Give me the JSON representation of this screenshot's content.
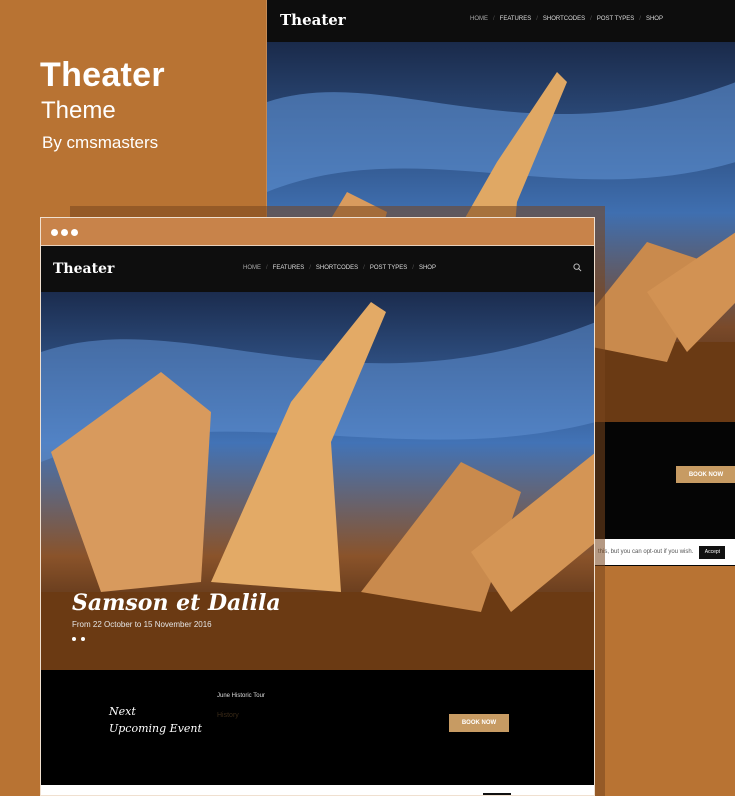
{
  "promo": {
    "title": "Theater",
    "subtitle": "Theme",
    "author": "By cmsmasters"
  },
  "site": {
    "logo": "Theater",
    "menu": [
      "HOME",
      "FEATURES",
      "SHORTCODES",
      "POST TYPES",
      "SHOP"
    ],
    "search_icon": "search-icon"
  },
  "hero": {
    "title": "Samson et Dalila",
    "date": "From 22 October to 15 November 2016"
  },
  "event": {
    "heading_line1": "Next",
    "heading_line2": "Upcoming Event",
    "title": "June Historic Tour",
    "subtitle": "History",
    "button": "BOOK NOW"
  },
  "cookie": {
    "text": "this, but you can opt-out if you wish.",
    "accept": "Accept"
  },
  "colors": {
    "background": "#b87333",
    "accent_button": "#c79b63",
    "titlebar": "#c8834a"
  }
}
